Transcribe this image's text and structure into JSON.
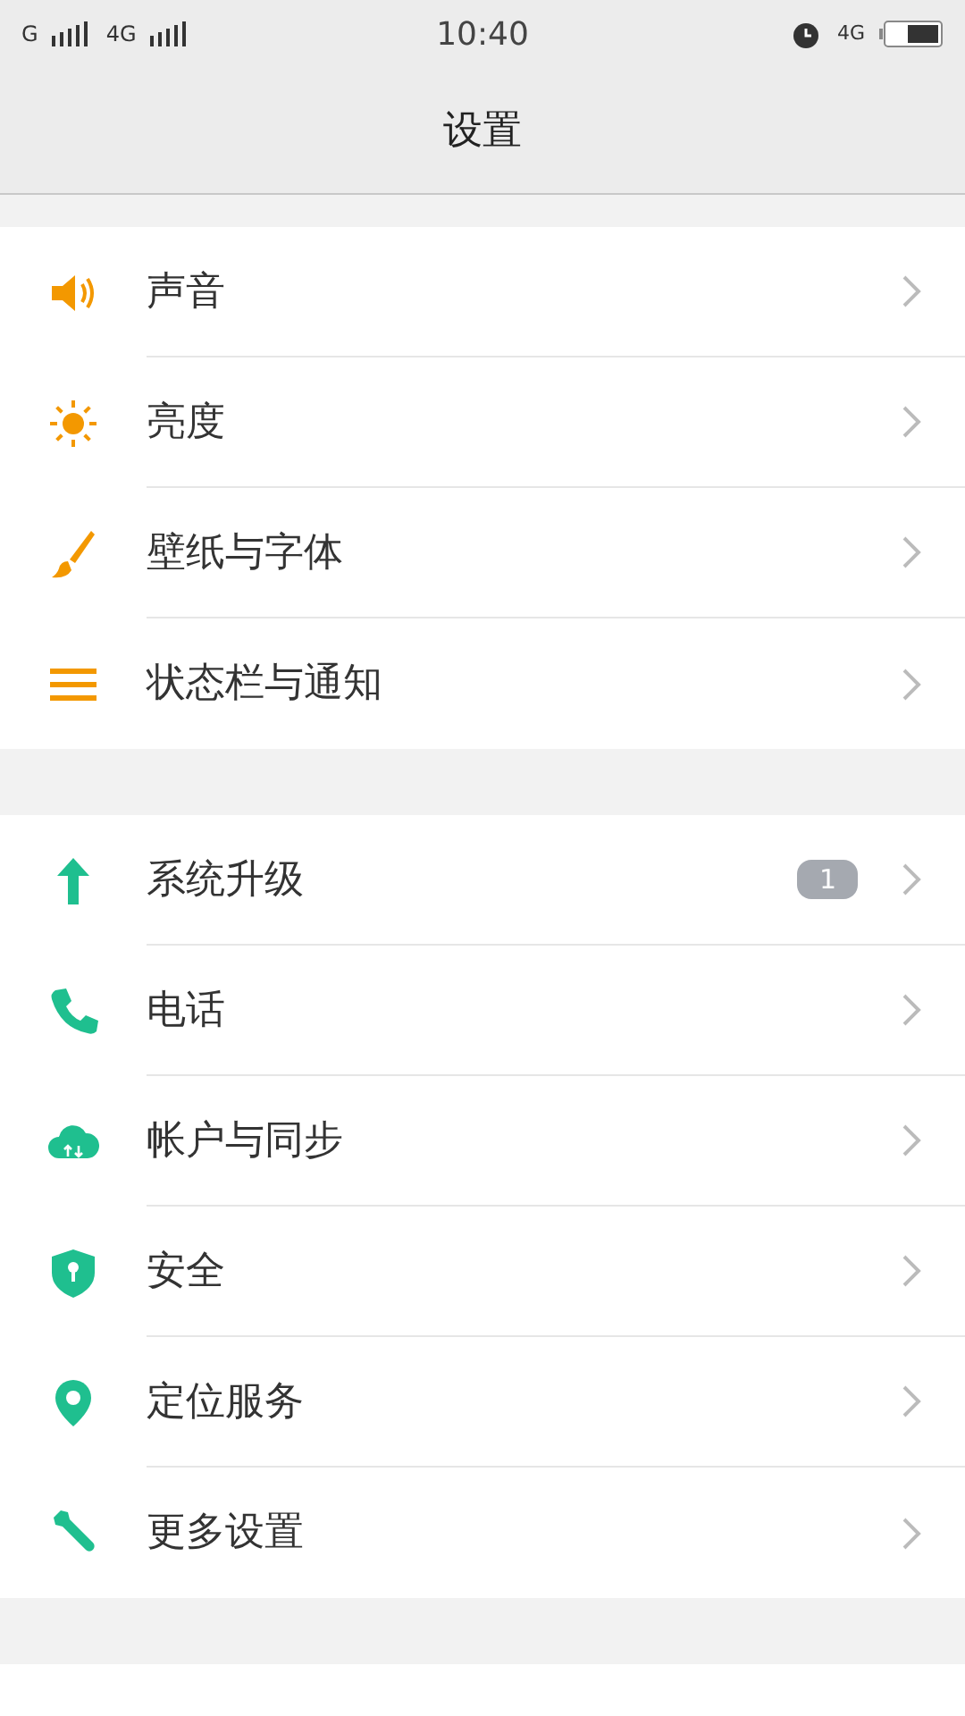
{
  "status_bar": {
    "sim1": "G",
    "sim2": "4G",
    "time": "10:40",
    "network": "4G"
  },
  "header": {
    "title": "设置"
  },
  "groups": [
    {
      "color": "#f39800",
      "items": [
        {
          "label": "声音"
        },
        {
          "label": "亮度"
        },
        {
          "label": "壁纸与字体"
        },
        {
          "label": "状态栏与通知"
        }
      ]
    },
    {
      "color": "#1fbf8f",
      "items": [
        {
          "label": "系统升级",
          "badge": "1"
        },
        {
          "label": "电话"
        },
        {
          "label": "帐户与同步"
        },
        {
          "label": "安全"
        },
        {
          "label": "定位服务"
        },
        {
          "label": "更多设置"
        }
      ]
    }
  ]
}
